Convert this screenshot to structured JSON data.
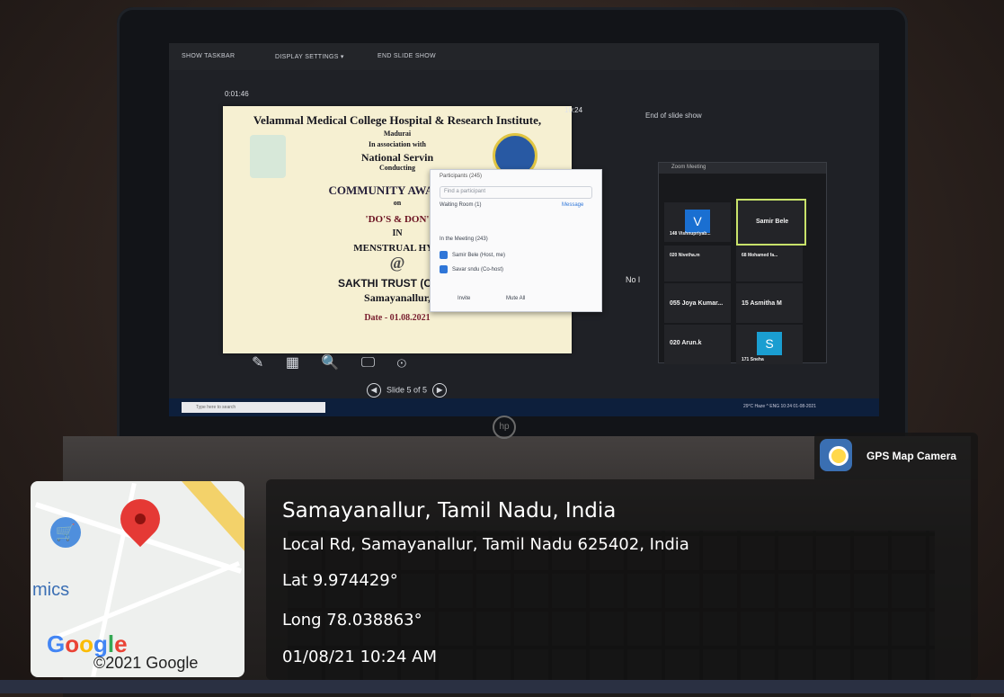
{
  "screen": {
    "topbar": {
      "show_taskbar": "SHOW TASKBAR",
      "display_settings": "DISPLAY SETTINGS ▾",
      "end_slide_show": "END SLIDE SHOW"
    },
    "timer": "0:01:46",
    "clock": "10:24",
    "end_of_show": "End of slide show",
    "slide": {
      "line1": "Velammal Medical College Hospital & Research Institute,",
      "line2": "Madurai",
      "line3": "In association with",
      "line4": "National Servin",
      "line5": "Conducting",
      "line6": "COMMUNITY AWARENE",
      "line7": "on",
      "line8": "'DO'S & DON'",
      "line9": "IN",
      "line10": "MENSTRUAL HYG",
      "line11": "@",
      "line12": "SAKTHI TRUST (CHILD",
      "line13": "Samayanallur,",
      "line14": "Date - 01.08.2021"
    },
    "participants": {
      "title": "Participants (245)",
      "search_placeholder": "Find a participant",
      "waiting": "Waiting Room (1)",
      "waiting_action": "Message",
      "in_meeting": "In the Meeting (243)",
      "row1": "Samir Bele (Host, me)",
      "row2": "Savar sndu (Co-host)",
      "invite": "Invite",
      "mute_all": "Mute All"
    },
    "zoom_title": "Zoom Meeting",
    "tiles": {
      "t1_letter": "V",
      "t1_name": "148 Vishnupriyab...",
      "t2_name": "Samir Bele",
      "t3_name": "020 Nivetha.m",
      "t4_name": "68 Mohamed fa...",
      "t5_name": "055 Joya Kumar...",
      "t6_name": "15 Asmitha M",
      "t7_name": "020 Arun.k",
      "t8_letter": "S",
      "t8_name": "171 Sneha"
    },
    "no_label": "No l",
    "tools": "✎ ▦ 🔍 🖵 ⊙",
    "slide_nav": "Slide 5 of 5",
    "taskbar_search": "Type here to search",
    "tray": "29°C Haze  ^  ENG  10:24  01-08-2021"
  },
  "overlay": {
    "badge": "GPS Map Camera",
    "city": "Samayanallur, Tamil Nadu, India",
    "address": "Local Rd, Samayanallur, Tamil Nadu 625402, India",
    "lat": "Lat 9.974429°",
    "long": "Long 78.038863°",
    "datetime": "01/08/21 10:24 AM",
    "map_label": "mics",
    "google": "Google",
    "copyright": "©2021 Google"
  },
  "colors": {
    "overlay_bg": "#141414",
    "pin": "#e53935",
    "road": "#f3d26a",
    "zoom_blue_tile": "#1a6fd1",
    "zoom_cyan_tile": "#1a9ed1",
    "host_tile_border": "#c8e26a"
  },
  "icons": [
    "cart-icon",
    "map-pin-icon",
    "gps-camera-icon",
    "hp-logo-icon"
  ]
}
